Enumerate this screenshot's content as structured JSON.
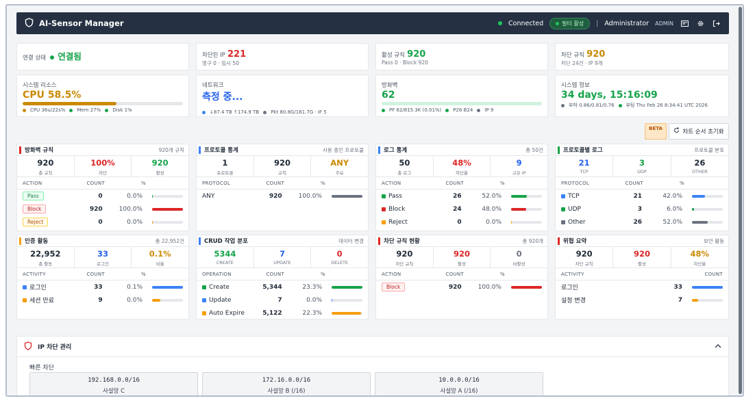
{
  "app": {
    "title": "AI-Sensor Manager",
    "connected": "Connected",
    "filter": "필터 활성",
    "user": "Administrator",
    "role": "ADMIN"
  },
  "summary": [
    {
      "label": "연결 상태",
      "value": "연결됨",
      "color": "#16a34a"
    },
    {
      "label": "차단된 IP",
      "value": "221",
      "sub": "영구 0 · 임시 50",
      "color": "#dc2626"
    },
    {
      "label": "활성 규칙",
      "value": "920",
      "sub": "Pass 0 · Block 920",
      "color": "#16a34a"
    },
    {
      "label": "차단 규칙",
      "value": "920",
      "sub": "차단 24건 · IP 9개",
      "color": "#ca8a04"
    }
  ],
  "resources": {
    "label": "시스템 리소스",
    "value": "CPU 58.5%",
    "progress": 0.585,
    "l1": "CPU 36u/22s%",
    "l2": "Mem 27%",
    "l3": "Disk 1%"
  },
  "network": {
    "label": "네트워크",
    "value": "측정 중...",
    "l1": "↓87.4 TB ↑174.9 TB",
    "l2": "Pkt 80.8G/161.7G · IF 5"
  },
  "firewall": {
    "label": "방화벽",
    "value": "62",
    "l1": "PF 62/815.3K (0.01%)",
    "l2": "P26 B24",
    "l3": "IP 9"
  },
  "sysinfo": {
    "label": "시스템 정보",
    "value": "34 days, 15:16:09",
    "l1": "부하 0.86/0.81/0.76",
    "l2": "부팅 Thu Feb 26 8:34:41 UTC 2026"
  },
  "beta": "BETA",
  "reset": "차트 순서 초기화",
  "panels": [
    {
      "title": "방화벽 규칙",
      "meta": "920개 규칙",
      "accent": "#dc2626",
      "stats": [
        {
          "v": "920",
          "l": "총 규칙",
          "c": "#1f2937"
        },
        {
          "v": "100%",
          "l": "차단",
          "c": "#dc2626"
        },
        {
          "v": "920",
          "l": "활성",
          "c": "#16a34a"
        }
      ],
      "cols": [
        "ACTION",
        "COUNT",
        "%",
        ""
      ],
      "rows": [
        {
          "tag": "pass",
          "n": "Pass",
          "c": "0",
          "p": "0.0%",
          "f": 0.0,
          "col": "#16a34a"
        },
        {
          "tag": "block",
          "n": "Block",
          "c": "920",
          "p": "100.0%",
          "f": 1.0,
          "col": "#dc2626"
        },
        {
          "tag": "reject",
          "n": "Reject",
          "c": "0",
          "p": "0.0%",
          "f": 0.0,
          "col": "#f59e0b"
        }
      ]
    },
    {
      "title": "프로토콜 통계",
      "meta": "사용 중인 프로토콜",
      "accent": "#3b82f6",
      "stats": [
        {
          "v": "1",
          "l": "프로토콜",
          "c": "#1f2937"
        },
        {
          "v": "920",
          "l": "규칙",
          "c": "#1f2937"
        },
        {
          "v": "ANY",
          "l": "주요",
          "c": "#ca8a04"
        }
      ],
      "cols": [
        "PROTOCOL",
        "COUNT",
        "%",
        ""
      ],
      "rows": [
        {
          "n": "ANY",
          "c": "920",
          "p": "100.0%",
          "f": 1.0,
          "col": "#6b7280"
        }
      ]
    },
    {
      "title": "로그 통계",
      "meta": "총 50건",
      "accent": "#3b82f6",
      "stats": [
        {
          "v": "50",
          "l": "총 로그",
          "c": "#1f2937"
        },
        {
          "v": "48%",
          "l": "차단율",
          "c": "#dc2626"
        },
        {
          "v": "9",
          "l": "고유 IP",
          "c": "#2563eb"
        }
      ],
      "cols": [
        "ACTION",
        "COUNT",
        "%",
        ""
      ],
      "rows": [
        {
          "sq": "#16a34a",
          "n": "Pass",
          "c": "26",
          "p": "52.0%",
          "f": 0.52,
          "col": "#16a34a"
        },
        {
          "sq": "#dc2626",
          "n": "Block",
          "c": "24",
          "p": "48.0%",
          "f": 0.48,
          "col": "#dc2626"
        },
        {
          "sq": "#f59e0b",
          "n": "Reject",
          "c": "0",
          "p": "0.0%",
          "f": 0.0,
          "col": "#f59e0b"
        }
      ]
    },
    {
      "title": "프로토콜별 로그",
      "meta": "프로토콜 분포",
      "accent": "#16a34a",
      "stats": [
        {
          "v": "21",
          "l": "TCP",
          "c": "#2563eb"
        },
        {
          "v": "3",
          "l": "UDP",
          "c": "#16a34a"
        },
        {
          "v": "26",
          "l": "OTHER",
          "c": "#1f2937"
        }
      ],
      "cols": [
        "PROTOCOL",
        "COUNT",
        "%",
        ""
      ],
      "rows": [
        {
          "sq": "#3b82f6",
          "n": "TCP",
          "c": "21",
          "p": "42.0%",
          "f": 0.42,
          "col": "#3b82f6"
        },
        {
          "sq": "#16a34a",
          "n": "UDP",
          "c": "3",
          "p": "6.0%",
          "f": 0.06,
          "col": "#16a34a"
        },
        {
          "sq": "#6b7280",
          "n": "Other",
          "c": "26",
          "p": "52.0%",
          "f": 0.52,
          "col": "#6b7280"
        }
      ]
    },
    {
      "title": "인증 활동",
      "meta": "총 22,952건",
      "accent": "#f59e0b",
      "stats": [
        {
          "v": "22,952",
          "l": "총 활동",
          "c": "#1f2937"
        },
        {
          "v": "33",
          "l": "로그인",
          "c": "#2563eb"
        },
        {
          "v": "0.1%",
          "l": "비율",
          "c": "#ca8a04"
        }
      ],
      "cols": [
        "ACTIVITY",
        "COUNT",
        "%",
        ""
      ],
      "rows": [
        {
          "sq": "#3b82f6",
          "n": "로그인",
          "c": "33",
          "p": "0.1%",
          "f": 1.0,
          "col": "#3b82f6"
        },
        {
          "sq": "#f59e0b",
          "n": "세션 만료",
          "c": "9",
          "p": "0.0%",
          "f": 0.27,
          "col": "#f59e0b"
        }
      ]
    },
    {
      "title": "CRUD 작업 분포",
      "meta": "데이터 변경",
      "accent": "#3b82f6",
      "stats": [
        {
          "v": "5344",
          "l": "CREATE",
          "c": "#16a34a"
        },
        {
          "v": "7",
          "l": "UPDATE",
          "c": "#2563eb"
        },
        {
          "v": "0",
          "l": "DELETE",
          "c": "#dc2626"
        }
      ],
      "cols": [
        "OPERATION",
        "COUNT",
        "%",
        ""
      ],
      "rows": [
        {
          "sq": "#16a34a",
          "n": "Create",
          "c": "5,344",
          "p": "23.3%",
          "f": 1.0,
          "col": "#16a34a"
        },
        {
          "sq": "#3b82f6",
          "n": "Update",
          "c": "7",
          "p": "0.0%",
          "f": 0.0,
          "col": "#3b82f6"
        },
        {
          "sq": "#f59e0b",
          "n": "Auto Expire",
          "c": "5,122",
          "p": "22.3%",
          "f": 0.96,
          "col": "#f59e0b"
        }
      ]
    },
    {
      "title": "차단 규칙 현황",
      "meta": "총 920개",
      "accent": "#dc2626",
      "stats": [
        {
          "v": "920",
          "l": "차단 규칙",
          "c": "#1f2937"
        },
        {
          "v": "920",
          "l": "활성",
          "c": "#dc2626"
        },
        {
          "v": "0",
          "l": "비활성",
          "c": "#6b7280"
        }
      ],
      "cols": [
        "ACTION",
        "COUNT",
        "%",
        ""
      ],
      "rows": [
        {
          "tag": "block",
          "n": "Block",
          "c": "920",
          "p": "100.0%",
          "f": 1.0,
          "col": "#dc2626"
        }
      ]
    },
    {
      "title": "위협 요약",
      "meta": "보안 활동",
      "accent": "#dc2626",
      "stats": [
        {
          "v": "920",
          "l": "차단 규칙",
          "c": "#1f2937"
        },
        {
          "v": "920",
          "l": "활성",
          "c": "#dc2626"
        },
        {
          "v": "48%",
          "l": "차단율",
          "c": "#ca8a04"
        }
      ],
      "cols": [
        "ACTIVITY",
        "",
        "COUNT",
        ""
      ],
      "rows": [
        {
          "n": "로그인",
          "c": "33",
          "p": "",
          "f": 1.0,
          "col": "#3b82f6"
        },
        {
          "n": "설정 변경",
          "c": "7",
          "p": "",
          "f": 0.2,
          "col": "#f59e0b"
        }
      ]
    }
  ],
  "ipblock": {
    "title": "IP 차단 관리",
    "quick": "빠른 차단",
    "items": [
      {
        "ip": "192.168.0.0/16",
        "name": "사설망 C"
      },
      {
        "ip": "172.16.0.0/16",
        "name": "사설망 B (/16)"
      },
      {
        "ip": "10.0.0.0/16",
        "name": "사설망 A (/16)"
      }
    ]
  }
}
